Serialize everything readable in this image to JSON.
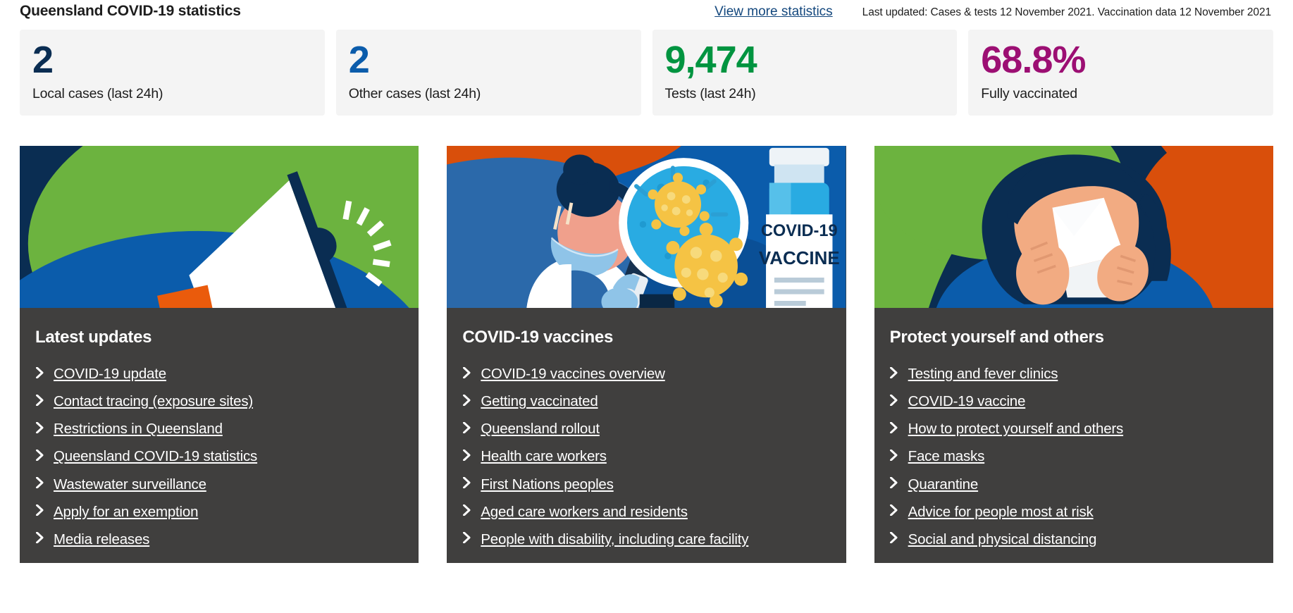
{
  "header": {
    "title": "Queensland COVID-19 statistics",
    "view_more_label": "View more statistics",
    "last_updated": "Last updated: Cases & tests 12 November 2021. Vaccination data 12 November 2021"
  },
  "stats": [
    {
      "value": "2",
      "label": "Local cases (last 24h)",
      "color": "#0a2d52"
    },
    {
      "value": "2",
      "label": "Other cases (last 24h)",
      "color": "#0b5cab"
    },
    {
      "value": "9,474",
      "label": "Tests (last 24h)",
      "color": "#009440"
    },
    {
      "value": "68.8%",
      "label": "Fully vaccinated",
      "color": "#9c0f73"
    }
  ],
  "cards": [
    {
      "image": "megaphone-illustration",
      "heading": "Latest updates",
      "links": [
        "COVID-19 update",
        "Contact tracing (exposure sites)",
        "Restrictions in Queensland",
        "Queensland COVID-19 statistics",
        "Wastewater surveillance",
        "Apply for an exemption",
        "Media releases"
      ]
    },
    {
      "image": "scientist-microscope-vaccine-illustration",
      "vial_line1": "COVID-19",
      "vial_line2": "VACCINE",
      "heading": "COVID-19 vaccines",
      "links": [
        "COVID-19 vaccines overview",
        "Getting vaccinated",
        "Queensland rollout",
        "Health care workers",
        "First Nations peoples",
        "Aged care workers and residents",
        "People with disability, including care facility"
      ]
    },
    {
      "image": "person-sneezing-tissue-illustration",
      "heading": "Protect yourself and others",
      "links": [
        "Testing and fever clinics",
        "COVID-19 vaccine",
        "How to protect yourself and others",
        "Face masks",
        "Quarantine",
        "Advice for people most at risk",
        "Social and physical distancing"
      ]
    }
  ],
  "palette": {
    "navy": "#0a2d52",
    "green": "#6cb33f",
    "blue": "#0b5cab",
    "orange": "#ea5b0c",
    "card_bg": "#403f3e",
    "stat_bg": "#f4f4f4",
    "link_blue": "#13477d"
  }
}
